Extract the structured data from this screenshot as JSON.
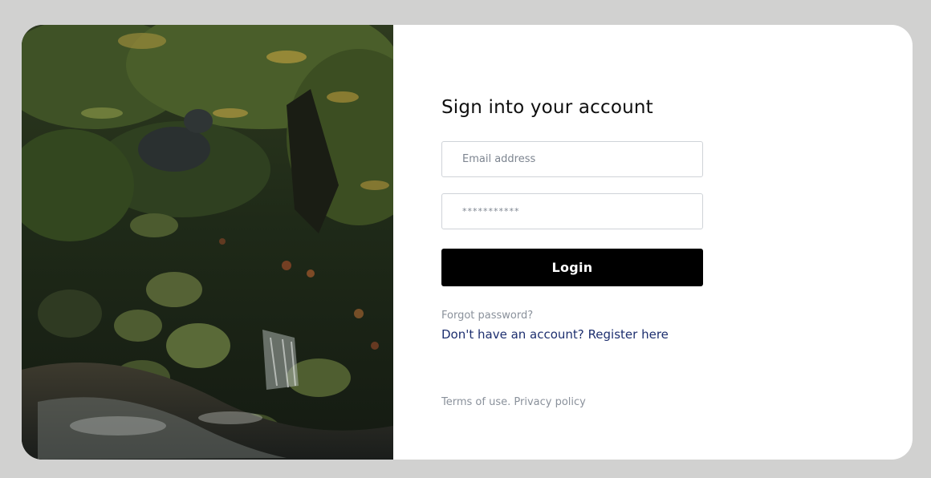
{
  "image": {
    "description": ""
  },
  "form": {
    "title": "Sign into your account",
    "email_placeholder": "Email address",
    "password_placeholder": "***********",
    "login_label": "Login",
    "forgot_label": "Forgot password?",
    "register_prefix": "Don't have an account?",
    "register_link": "Register here"
  },
  "footer": {
    "terms": "Terms of use.",
    "privacy": "Privacy policy"
  },
  "colors": {
    "page_bg": "#d1d1d0",
    "card_bg": "#ffffff",
    "button_bg": "#000000",
    "link": "#1d2f6f",
    "muted_text": "#8a919b"
  }
}
